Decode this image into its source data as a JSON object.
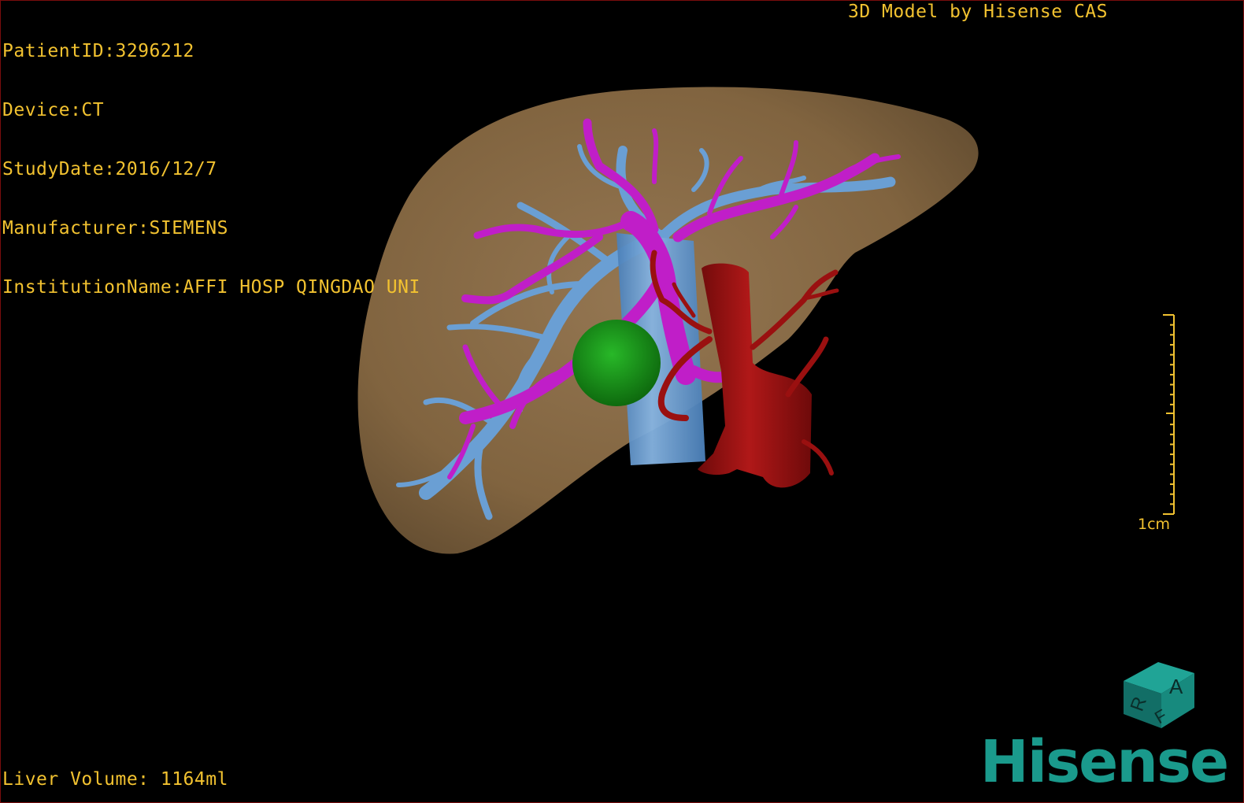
{
  "app": {
    "title": "3D Model by Hisense CAS",
    "brand_logo": "Hisense",
    "brand_color": "#1a9a8c"
  },
  "overlay": {
    "patient_id": "PatientID:3296212",
    "device": "Device:CT",
    "study_date": "StudyDate:2016/12/7",
    "manufacturer": "Manufacturer:SIEMENS",
    "institution": "InstitutionName:AFFI HOSP QINGDAO UNI",
    "liver_volume": "Liver Volume: 1164ml",
    "text_color": "#f2c230"
  },
  "scale_bar": {
    "label": "1cm"
  },
  "orientation_cube": {
    "face_front": "A",
    "face_left": "R",
    "face_bottom": "F",
    "color": "#1a8a82"
  },
  "model_colors": {
    "liver": "#8a6b45",
    "hepatic_vein": "#6a9fd4",
    "portal_vein": "#c01ec8",
    "tumor": "#1e8e1e",
    "artery": "#9a1010"
  }
}
